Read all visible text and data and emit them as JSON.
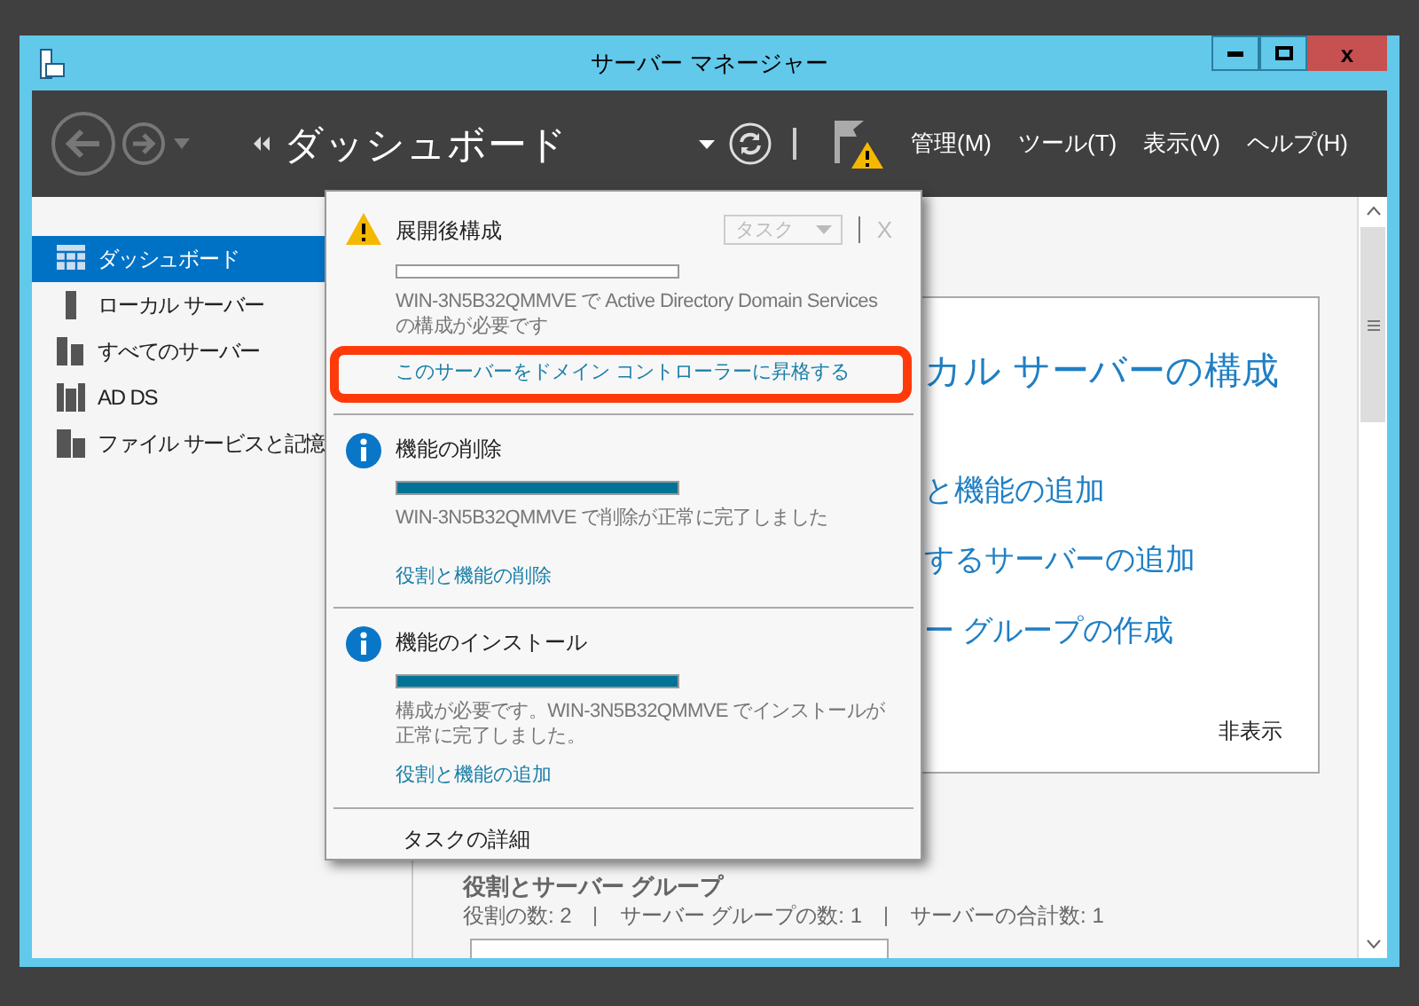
{
  "window": {
    "title": "サーバー マネージャー",
    "close_label": "x"
  },
  "toolbar": {
    "breadcrumb": "ダッシュボード",
    "menu": [
      "管理(M)",
      "ツール(T)",
      "表示(V)",
      "ヘルプ(H)"
    ]
  },
  "sidebar": {
    "items": [
      {
        "label": "ダッシュボード",
        "selected": true
      },
      {
        "label": "ローカル サーバー",
        "selected": false
      },
      {
        "label": "すべてのサーバー",
        "selected": false
      },
      {
        "label": "AD DS",
        "selected": false
      },
      {
        "label": "ファイル サービスと記憶",
        "selected": false
      }
    ]
  },
  "welcome": {
    "heading": "カル サーバーの構成",
    "links": [
      "と機能の追加",
      "するサーバーの追加",
      "ー グループの作成"
    ],
    "hide": "非表示"
  },
  "roles": {
    "title": "役割とサーバー グループ",
    "stats": [
      "役割の数: 2",
      "サーバー グループの数: 1",
      "サーバーの合計数: 1"
    ]
  },
  "notifications": {
    "task_button": "タスク",
    "close": "X",
    "footer": "タスクの詳細",
    "items": [
      {
        "kind": "warning",
        "title": "展開後構成",
        "level": 0,
        "message": "WIN-3N5B32QMMVE で Active Directory Domain Services の構成が必要です",
        "link": "このサーバーをドメイン コントローラーに昇格する",
        "highlighted": true
      },
      {
        "kind": "info",
        "title": "機能の削除",
        "level": 1,
        "message": "WIN-3N5B32QMMVE で削除が正常に完了しました",
        "link": "役割と機能の削除",
        "highlighted": false
      },
      {
        "kind": "info",
        "title": "機能のインストール",
        "level": 1,
        "message": "構成が必要です。WIN-3N5B32QMMVE でインストールが正常に完了しました。",
        "link": "役割と機能の追加",
        "highlighted": false
      }
    ]
  }
}
